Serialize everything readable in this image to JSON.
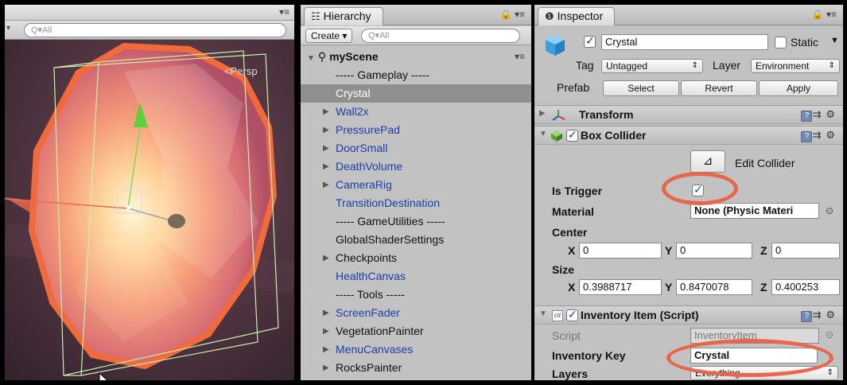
{
  "scene": {
    "menu_glyph": "▾≡",
    "search_placeholder": "Q▾All",
    "view_label": "<Persp"
  },
  "hierarchy": {
    "tab_icon": "☷",
    "tab_label": "Hierarchy",
    "tab_right": "🔒 ▾≡",
    "create_label": "Create ▾",
    "search_placeholder": "Q▾All",
    "scene_name": "myScene",
    "rows": [
      {
        "label": "----- Gameplay -----",
        "type": "plain",
        "arrow": "",
        "selected": false
      },
      {
        "label": "Crystal",
        "type": "prefab",
        "arrow": "",
        "selected": true
      },
      {
        "label": "Wall2x",
        "type": "prefab",
        "arrow": "▶",
        "selected": false
      },
      {
        "label": "PressurePad",
        "type": "prefab",
        "arrow": "▶",
        "selected": false
      },
      {
        "label": "DoorSmall",
        "type": "prefab",
        "arrow": "▶",
        "selected": false
      },
      {
        "label": "DeathVolume",
        "type": "prefab",
        "arrow": "▶",
        "selected": false
      },
      {
        "label": "CameraRig",
        "type": "prefab",
        "arrow": "▶",
        "selected": false
      },
      {
        "label": "TransitionDestination",
        "type": "prefab",
        "arrow": "",
        "selected": false
      },
      {
        "label": "----- GameUtilities -----",
        "type": "plain",
        "arrow": "",
        "selected": false
      },
      {
        "label": "GlobalShaderSettings",
        "type": "plain",
        "arrow": "",
        "selected": false
      },
      {
        "label": "Checkpoints",
        "type": "plain",
        "arrow": "▶",
        "selected": false
      },
      {
        "label": "HealthCanvas",
        "type": "prefab",
        "arrow": "",
        "selected": false
      },
      {
        "label": "----- Tools -----",
        "type": "plain",
        "arrow": "",
        "selected": false
      },
      {
        "label": "ScreenFader",
        "type": "prefab",
        "arrow": "▶",
        "selected": false
      },
      {
        "label": "VegetationPainter",
        "type": "plain",
        "arrow": "▶",
        "selected": false
      },
      {
        "label": "MenuCanvases",
        "type": "prefab",
        "arrow": "▶",
        "selected": false
      },
      {
        "label": "RocksPainter",
        "type": "plain",
        "arrow": "▶",
        "selected": false
      }
    ]
  },
  "inspector": {
    "tab_icon": "❶",
    "tab_label": "Inspector",
    "tab_right": "🔒 ▾≡",
    "object_name": "Crystal",
    "static_label": "Static",
    "tag_label": "Tag",
    "tag_value": "Untagged",
    "layer_label": "Layer",
    "layer_value": "Environment",
    "prefab_label": "Prefab",
    "prefab_buttons": [
      "Select",
      "Revert",
      "Apply"
    ],
    "transform": {
      "title": "Transform"
    },
    "box_collider": {
      "title": "Box Collider",
      "edit_collider_label": "Edit Collider",
      "is_trigger_label": "Is Trigger",
      "is_trigger": true,
      "material_label": "Material",
      "material_value": "None (Physic Materi",
      "center_label": "Center",
      "center": {
        "x": "0",
        "y": "0",
        "z": "0"
      },
      "size_label": "Size",
      "size": {
        "x": "0.3988717",
        "y": "0.8470078",
        "z": "0.400253"
      }
    },
    "inventory_item": {
      "title": "Inventory Item (Script)",
      "script_label": "Script",
      "script_value": "InventoryItem",
      "key_label": "Inventory Key",
      "key_value": "Crystal",
      "layers_label": "Layers",
      "layers_value": "Everything"
    },
    "axis_labels": {
      "x": "X",
      "y": "Y",
      "z": "Z"
    }
  },
  "colors": {
    "highlight_ring": "#e8664a",
    "prefab_text": "#1a3fa6",
    "selection": "#8f8f8f"
  }
}
